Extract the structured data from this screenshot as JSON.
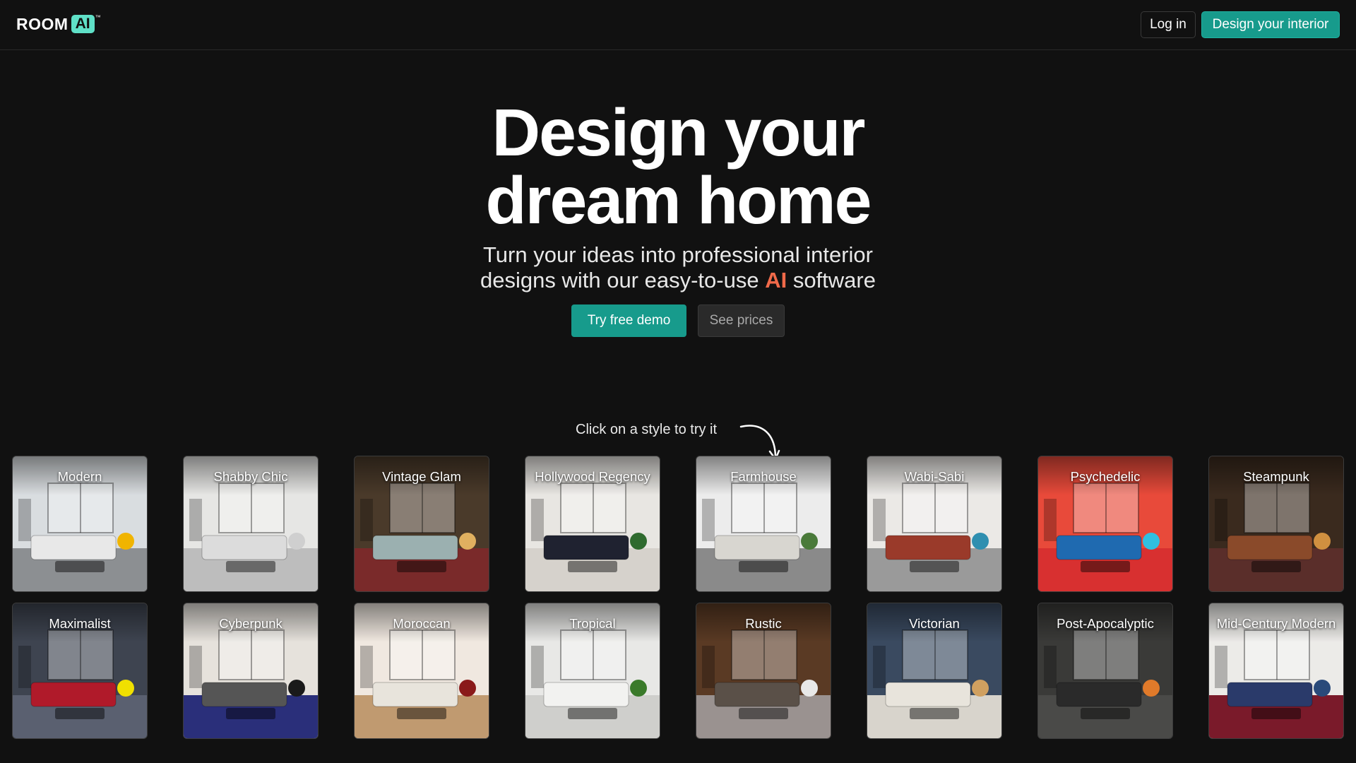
{
  "header": {
    "logo_room": "ROOM",
    "logo_ai": "AI",
    "logo_tm": "™",
    "login_label": "Log in",
    "design_label": "Design your interior"
  },
  "hero": {
    "title_line1": "Design your",
    "title_line2": "dream home",
    "subtitle_line1": "Turn your ideas into professional interior",
    "subtitle_line2_pre": "designs with our easy-to-use ",
    "subtitle_ai": "AI",
    "subtitle_line2_post": " software",
    "demo_label": "Try free demo",
    "prices_label": "See prices",
    "hint": "Click on a style to try it"
  },
  "styles": [
    {
      "name": "Modern",
      "wall": "#d9dde0",
      "floor": "#8c8f92",
      "accent": "#f0b400",
      "sofa": "#e8e8e8"
    },
    {
      "name": "Shabby Chic",
      "wall": "#e6e6e4",
      "floor": "#bdbdbd",
      "accent": "#cfcfcf",
      "sofa": "#dcdcdc"
    },
    {
      "name": "Vintage Glam",
      "wall": "#4a3a2a",
      "floor": "#7a2a2a",
      "accent": "#e0b060",
      "sofa": "#9bb0b0"
    },
    {
      "name": "Hollywood Regency",
      "wall": "#e8e6e2",
      "floor": "#d6d2cc",
      "accent": "#2f6b2f",
      "sofa": "#1f2230"
    },
    {
      "name": "Farmhouse",
      "wall": "#ececec",
      "floor": "#8a8a8a",
      "accent": "#4a7a3a",
      "sofa": "#d8d6d0"
    },
    {
      "name": "Wabi-Sabi",
      "wall": "#ebe9e6",
      "floor": "#9a9a9a",
      "accent": "#2f8fb0",
      "sofa": "#9a3a2a"
    },
    {
      "name": "Psychedelic",
      "wall": "#e84a3a",
      "floor": "#d83030",
      "accent": "#30c0e0",
      "sofa": "#1f6ab0"
    },
    {
      "name": "Steampunk",
      "wall": "#3a2a1e",
      "floor": "#5a2e2a",
      "accent": "#d09040",
      "sofa": "#8a4a2a"
    },
    {
      "name": "Maximalist",
      "wall": "#3e4450",
      "floor": "#5a6070",
      "accent": "#f0e000",
      "sofa": "#b01a2a"
    },
    {
      "name": "Cyberpunk",
      "wall": "#e6e2dc",
      "floor": "#2a2f7a",
      "accent": "#1a1a1a",
      "sofa": "#555555"
    },
    {
      "name": "Moroccan",
      "wall": "#f0e8e0",
      "floor": "#c09a70",
      "accent": "#8a1a1a",
      "sofa": "#e8e4dc"
    },
    {
      "name": "Tropical",
      "wall": "#e8e8e6",
      "floor": "#cfcfcc",
      "accent": "#3a7a2a",
      "sofa": "#f2f2f0"
    },
    {
      "name": "Rustic",
      "wall": "#5a3a24",
      "floor": "#9a9290",
      "accent": "#e8e8e8",
      "sofa": "#5a5048"
    },
    {
      "name": "Victorian",
      "wall": "#3a4a60",
      "floor": "#d8d4cc",
      "accent": "#d0a060",
      "sofa": "#e8e4dc"
    },
    {
      "name": "Post-Apocalyptic",
      "wall": "#3a3a38",
      "floor": "#4a4a48",
      "accent": "#e07a2a",
      "sofa": "#2a2a2a"
    },
    {
      "name": "Mid-Century Modern",
      "wall": "#ecebe8",
      "floor": "#7a1a2a",
      "accent": "#2a4a7a",
      "sofa": "#2a3a6a"
    }
  ]
}
